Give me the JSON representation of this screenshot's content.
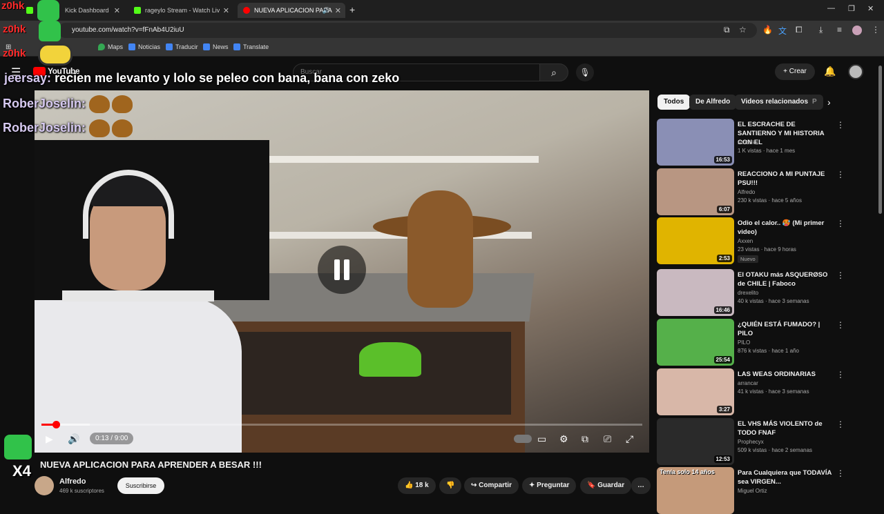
{
  "browser": {
    "tabs": [
      {
        "label": "Kick Dashboard",
        "color": "#53fc18"
      },
      {
        "label": "rageylo Stream - Watch Live on",
        "color": "#53fc18"
      },
      {
        "label": "NUEVA APLICACION PARA",
        "color": "#ff0000"
      }
    ],
    "url": "youtube.com/watch?v=fFnAb4U2iuU",
    "bookmarks": [
      "Maps",
      "Noticias",
      "Traducir",
      "News",
      "Translate"
    ]
  },
  "youtube": {
    "logo": "YouTube",
    "search_placeholder": "Buscar",
    "create_label": "Crear"
  },
  "overlay": {
    "brand_text": "z0hk",
    "chat_user1": "jeersay:",
    "chat_msg1": "recien me levanto y lolo se peleo con bana, bana con zeko",
    "chat_user2": "RoberJoselin:",
    "chat_user3": "RoberJoselin:",
    "counter_text": "X4"
  },
  "player": {
    "time": "0:13 / 9:00",
    "progress": 0.024,
    "buffered": 0.08
  },
  "video": {
    "title": "NUEVA APLICACION PARA APRENDER A BESAR !!!",
    "channel": "Alfredo",
    "subscribers": "469 k suscriptores",
    "subscribe_label": "Suscribirse",
    "likes": "18 k",
    "share_label": "Compartir",
    "ask_label": "Preguntar",
    "save_label": "Guardar"
  },
  "sidebar": {
    "chips": [
      "Todos",
      "De Alfredo",
      "Videos relacionados",
      "P"
    ],
    "items": [
      {
        "title": "EL ESCRACHE DE SANTIERNO Y MI HISTORIA CON EL",
        "channel": "scribble",
        "meta": "1 K vistas · hace 1 mes",
        "duration": "16:53",
        "thumb": "#8a8fb5"
      },
      {
        "title": "REACCIONO A MI PUNTAJE PSU!!!",
        "channel": "Alfredo",
        "meta": "230 k vistas · hace 5 años",
        "duration": "6:07",
        "thumb": "#b89682"
      },
      {
        "title": "Odio el calor.. 🥵 (Mi primer video)",
        "channel": "Axxen",
        "meta": "23 vistas · hace 9 horas",
        "duration": "2:53",
        "thumb": "#e0b400",
        "badge": "Nuevo"
      },
      {
        "title": "El OTAKU más ASQUERØSO de CHILE | Faboco",
        "channel": "drexelito",
        "meta": "40 k vistas · hace 3 semanas",
        "duration": "16:46",
        "thumb": "#c9b9c0"
      },
      {
        "title": "¿QUIÉN ESTÁ FUMADO? | PILO",
        "channel": "PILO",
        "meta": "876 k vistas · hace 1 año",
        "duration": "25:54",
        "thumb": "#55b04a"
      },
      {
        "title": "LAS WEAS ORDINARIAS",
        "channel": "arrancar",
        "meta": "41 k vistas · hace 3 semanas",
        "duration": "3:27",
        "thumb": "#d8b7a8"
      },
      {
        "title": "EL VHS MÁS VIOLENTO de TODO FNAF",
        "channel": "Prophecyx",
        "meta": "509 k vistas · hace 2 semanas",
        "duration": "12:53",
        "thumb": "#2a2a2a"
      },
      {
        "title": "Para Cualquiera que TODAVÍA sea VIRGEN...",
        "channel": "Miguel Ortiz",
        "meta": "",
        "duration": "",
        "thumb": "#c59a7a",
        "thumb_text": "Tenía solo 14 años"
      }
    ]
  }
}
